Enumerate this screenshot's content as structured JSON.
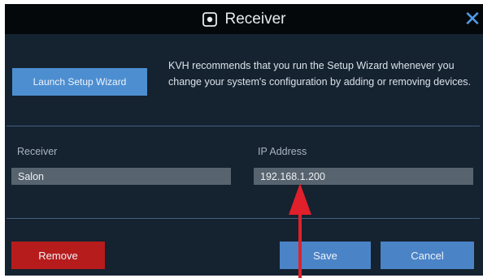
{
  "dialog": {
    "title": "Receiver",
    "title_icon": "receiver-icon",
    "close_icon": "close-icon",
    "close_glyph": "✕"
  },
  "wizard": {
    "button_label": "Launch Setup Wizard",
    "note": "KVH recommends that you run the Setup Wizard whenever you change your system's configuration by adding or removing devices."
  },
  "fields": {
    "receiver_label": "Receiver",
    "receiver_value": "Salon",
    "ip_label": "IP Address",
    "ip_value": "192.168.1.200"
  },
  "actions": {
    "remove_label": "Remove",
    "save_label": "Save",
    "cancel_label": "Cancel"
  },
  "colors": {
    "background": "#152230",
    "titlebar": "#05080b",
    "accent": "#4b83c7",
    "remove": "#b71c1c",
    "annotation_arrow": "#e0202a"
  }
}
